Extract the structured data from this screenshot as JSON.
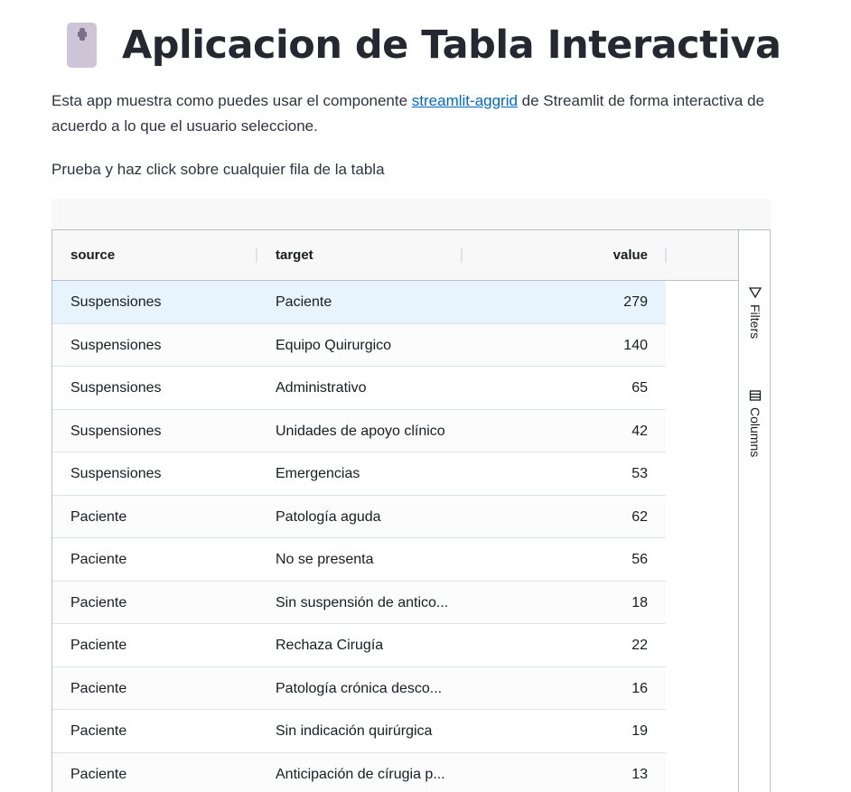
{
  "header": {
    "title": "Aplicacion de Tabla Interactiva",
    "logo_icon": "mouse-icon"
  },
  "intro": {
    "text_before_link": "Esta app muestra como puedes usar el componente ",
    "link_text": "streamlit-aggrid",
    "text_after_link": " de Streamlit de forma interactiva de acuerdo a lo que el usuario seleccione.",
    "instruction": "Prueba y haz click sobre cualquier fila de la tabla"
  },
  "grid": {
    "columns": {
      "source": "source",
      "target": "target",
      "value": "value"
    },
    "rows": [
      {
        "source": "Suspensiones",
        "target": "Paciente",
        "value": "279"
      },
      {
        "source": "Suspensiones",
        "target": "Equipo Quirurgico",
        "value": "140"
      },
      {
        "source": "Suspensiones",
        "target": "Administrativo",
        "value": "65"
      },
      {
        "source": "Suspensiones",
        "target": "Unidades de apoyo clínico",
        "value": "42"
      },
      {
        "source": "Suspensiones",
        "target": "Emergencias",
        "value": "53"
      },
      {
        "source": "Paciente",
        "target": "Patología aguda",
        "value": "62"
      },
      {
        "source": "Paciente",
        "target": "No se presenta",
        "value": "56"
      },
      {
        "source": "Paciente",
        "target": "Sin suspensión de antico...",
        "value": "18"
      },
      {
        "source": "Paciente",
        "target": "Rechaza Cirugía",
        "value": "22"
      },
      {
        "source": "Paciente",
        "target": "Patología crónica desco...",
        "value": "16"
      },
      {
        "source": "Paciente",
        "target": "Sin indicación quirúrgica",
        "value": "19"
      },
      {
        "source": "Paciente",
        "target": "Anticipación de círugia p...",
        "value": "13"
      }
    ],
    "selected_row_index": 0,
    "sidebar": {
      "filters_label": "Filters",
      "filters_icon": "filter-icon",
      "columns_label": "Columns",
      "columns_icon": "columns-icon"
    }
  },
  "colors": {
    "link": "#0068c9",
    "selected_row": "#e7f4fd",
    "logo": "#cdc4d7"
  }
}
